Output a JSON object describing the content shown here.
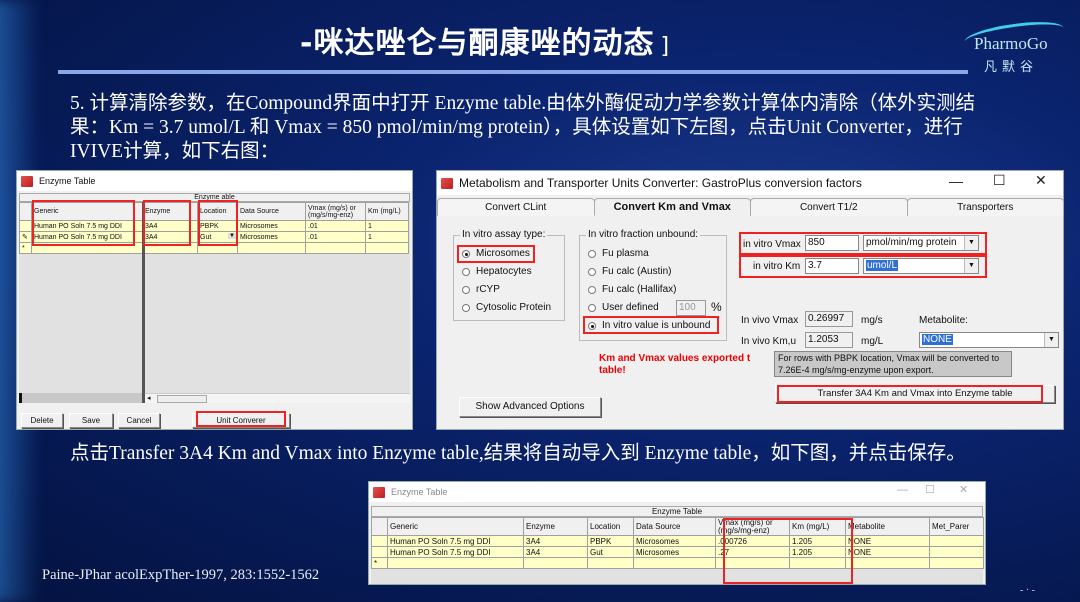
{
  "slide": {
    "title": "-咪达唑仑与酮康唑的动态",
    "title_trail": "]",
    "logo_en": "PharmoGo",
    "logo_cn": "凡默谷",
    "paragraph1": "5. 计算清除参数，在Compound界面中打开 Enzyme table.由体外酶促动力学参数计算体内清除（体外实测结果：Km = 3.7 umol/L 和 Vmax = 850 pmol/min/mg protein），具体设置如下左图，点击Unit Converter，进行IVIVE计算，如下右图：",
    "paragraph2": "点击Transfer 3A4 Km and Vmax into Enzyme table,结果将自动导入到 Enzyme table，如下图，并点击保存。",
    "citation": "Paine-JPhar   acolExpTher-1997, 283:1552-1562",
    "page_dots": "-  ·  -"
  },
  "enzyme_table_left": {
    "window_title": "Enzyme Table",
    "grid_caption": "Enzyme  able",
    "columns": [
      "Generic",
      "Enzyme",
      "Location",
      "Data Source",
      "Vmax (mg/s) or (mg/s/mg-enz)",
      "Km (mg/L)"
    ],
    "rows": [
      [
        "Human PO Soln 7.5 mg DDI",
        "3A4",
        "PBPK",
        "Microsomes",
        ".01",
        "1"
      ],
      [
        "Human PO Soln 7.5 mg DDI",
        "3A4",
        "Gut",
        "Microsomes",
        ".01",
        "1"
      ]
    ],
    "new_row_marker": "*",
    "buttons": {
      "delete": "Delete",
      "save": "Save",
      "cancel": "Cancel",
      "unit_converter": "Unit Converer"
    }
  },
  "converter": {
    "window_title": "Metabolism and Transporter Units Converter: GastroPlus conversion factors",
    "tabs": [
      "Convert CLint",
      "Convert Km and Vmax",
      "Convert T1/2",
      "Transporters"
    ],
    "active_tab": "Convert Km and Vmax",
    "assay_group": {
      "legend": "In vitro assay type:",
      "options": [
        "Microsomes",
        "Hepatocytes",
        "rCYP",
        "Cytosolic Protein"
      ],
      "selected": "Microsomes"
    },
    "fu_group": {
      "legend": "In vitro fraction unbound:",
      "options": [
        "Fu plasma",
        "Fu calc (Austin)",
        "Fu calc (Hallifax)",
        "User defined",
        "In vitro value is unbound"
      ],
      "selected": "In vitro value is unbound",
      "user_defined_value": "100",
      "user_defined_unit": "%"
    },
    "in_vitro_vmax": {
      "label": "in vitro Vmax",
      "value": "850",
      "unit": "pmol/min/mg protein"
    },
    "in_vitro_km": {
      "label": "in vitro Km",
      "value": "3.7",
      "unit": "umol/L"
    },
    "in_vivo_vmax": {
      "label": "In vivo Vmax",
      "value": "0.26997",
      "unit": "mg/s"
    },
    "in_vivo_kmu": {
      "label": "In vivo Km,u",
      "value": "1.2053",
      "unit": "mg/L"
    },
    "metabolite": {
      "label": "Metabolite:",
      "value": "NONE"
    },
    "warning": "Km and Vmax values exported t table!",
    "note": "For rows with PBPK location, Vmax will be converted to 7.26E-4 mg/s/mg-enzyme upon export.",
    "transfer_button": "Transfer 3A4 Km and Vmax into Enzyme table",
    "advanced_button": "Show Advanced Options"
  },
  "enzyme_table_result": {
    "window_title": "Enzyme Table",
    "grid_caption": "Enzyme Table",
    "columns": [
      "Generic",
      "Enzyme",
      "Location",
      "Data Source",
      "Vmax (mg/s) or (mg/s/mg-enz)",
      "Km (mg/L)",
      "Metabolite",
      "Met_Parer"
    ],
    "rows": [
      [
        "Human PO Soln 7.5 mg DDI",
        "3A4",
        "PBPK",
        "Microsomes",
        ".000726",
        "1.205",
        "NONE",
        ""
      ],
      [
        "Human PO Soln 7.5 mg DDI",
        "3A4",
        "Gut",
        "Microsomes",
        ".27",
        "1.205",
        "NONE",
        ""
      ]
    ],
    "new_row_marker": "*"
  }
}
